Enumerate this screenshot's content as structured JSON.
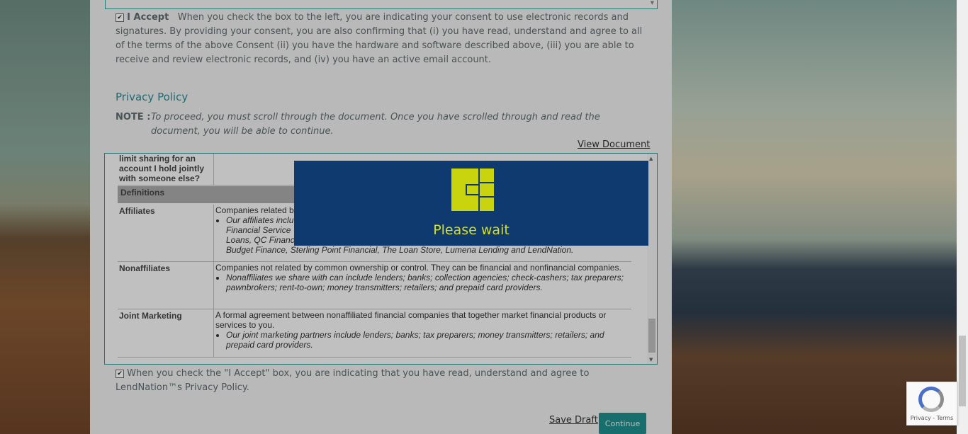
{
  "consent": {
    "accept_label": "I Accept",
    "text": "When you check the box to the left, you are indicating your consent to use electronic records and signatures. By providing your consent, you are also confirming that (i) you have read, understand and agree to all of the terms of the above Consent (ii) you have the hardware and software described above, (iii) you are able to receive and review electronic records, and (iv) you have an active email account.",
    "checked": true
  },
  "privacy": {
    "title": "Privacy Policy",
    "note_label": "NOTE :",
    "note_text": "To proceed, you must scroll through the document. Once you have scrolled through and read the document, you will be able to continue.",
    "view_document": "View Document"
  },
  "document": {
    "top_row_label": "limit sharing for an account I hold jointly with someone else?",
    "definitions_header": "Definitions",
    "rows": [
      {
        "term": "Affiliates",
        "definition": "Companies related by common ownership or control. They can be financial and nonfinancial companies.",
        "bullet": "Our affiliates include companies with a LendNation name and financial companies such as Community Financial Service Centers, CNG Financial, Check 'n Go, Allied Cash Advance, Xpress Loans, Cash Central, Check Mart, Loans, QC Financial Services, Budget Finance, Sterling Point Financial, The Loan Store, Lumena Lending and LendNation."
      },
      {
        "term": "Nonaffiliates",
        "definition": "Companies not related by common ownership or control. They can be financial and nonfinancial companies.",
        "bullet": "Nonaffiliates we share with can include lenders; banks; collection agencies; check-cashers; tax preparers; pawnbrokers; rent-to-own; money transmitters; retailers; and prepaid card providers."
      },
      {
        "term": "Joint Marketing",
        "definition": "A formal agreement between nonaffiliated financial companies that together market financial products or services to you.",
        "bullet": "Our joint marketing partners include lenders; banks; tax preparers; money transmitters; retailers; and prepaid card providers."
      }
    ],
    "affiliates_visible_line1": "Companies related b",
    "affiliates_visible_bullet1": "Our affiliates inclu",
    "affiliates_visible_line2": "Financial Service",
    "affiliates_visible_line3": "Loans, QC Financ",
    "affiliates_visible_line4": "Budget Finance, Sterling Point Financial, The Loan Store, Lumena Lending and LendNation."
  },
  "privacy_accept": {
    "text": "When you check the \"I Accept\" box, you are indicating that you have read, understand and agree to LendNation™s Privacy Policy.",
    "checked": true
  },
  "actions": {
    "save_draft": "Save Draft",
    "continue": "Continue"
  },
  "modal": {
    "message": "Please wait"
  },
  "recaptcha": {
    "terms": "Privacy - Terms"
  },
  "colors": {
    "accent": "#2d9a98",
    "modal_bg": "#0f3a70",
    "modal_text": "#d6df22"
  }
}
